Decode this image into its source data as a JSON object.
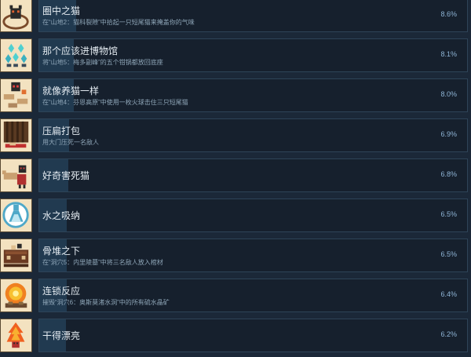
{
  "achievements": [
    {
      "title": "圈中之猫",
      "description": "在“山地2：猫科裂隙”中拾起一只短尾猫来掩盖你的气味",
      "percent_label": "8.6%",
      "percent": 8.6,
      "icon": "cat-in-circle-icon"
    },
    {
      "title": "那个应该进博物馆",
      "description": "将“山地5：梅多副峰”的五个钳锅都放回底座",
      "percent_label": "8.1%",
      "percent": 8.1,
      "icon": "crystal-pedestals-icon"
    },
    {
      "title": "就像养猫一样",
      "description": "在“山地4：芬恩高原”中使用一枚火球击住三只短尾猫",
      "percent_label": "8.0%",
      "percent": 8.0,
      "icon": "herding-cats-icon"
    },
    {
      "title": "压扁打包",
      "description": "用大门压死一名敌人",
      "percent_label": "6.9%",
      "percent": 6.9,
      "icon": "crushing-gate-icon"
    },
    {
      "title": "好奇害死猫",
      "description": "",
      "percent_label": "6.8%",
      "percent": 6.8,
      "icon": "curious-cat-icon"
    },
    {
      "title": "水之吸纳",
      "description": "",
      "percent_label": "6.5%",
      "percent": 6.5,
      "icon": "water-flask-icon"
    },
    {
      "title": "骨堆之下",
      "description": "在“洞穴5：内里陵墓”中将三名敌人放入棺材",
      "percent_label": "6.5%",
      "percent": 6.5,
      "icon": "coffin-icon"
    },
    {
      "title": "连锁反应",
      "description": "摧毁“洞穴6：奥斯莫渚水洞”中的所有硫水晶矿",
      "percent_label": "6.4%",
      "percent": 6.4,
      "icon": "explosion-icon"
    },
    {
      "title": "干得漂亮",
      "description": "",
      "percent_label": "6.2%",
      "percent": 6.2,
      "icon": "fire-hero-icon"
    }
  ]
}
